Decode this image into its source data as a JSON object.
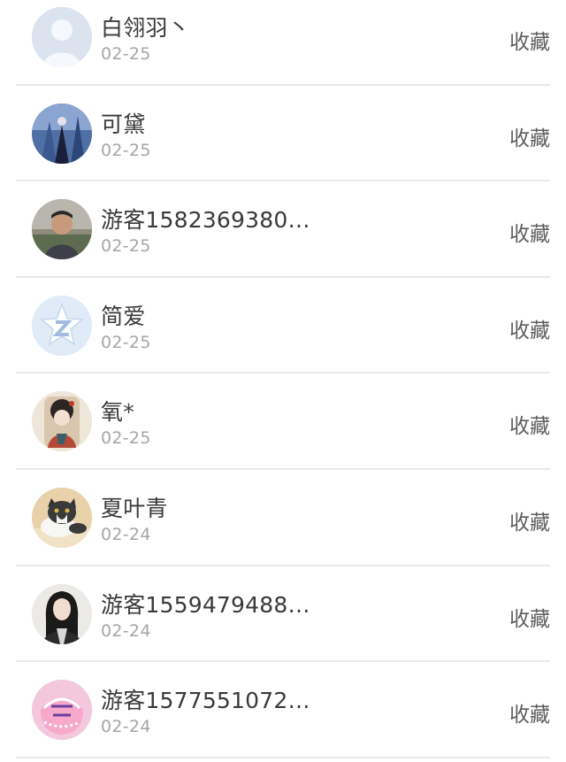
{
  "rows": [
    {
      "name": "白翎羽丶",
      "date": "02-25",
      "action": "收藏",
      "avatar": "default-person-avatar"
    },
    {
      "name": "可黛",
      "date": "02-25",
      "action": "收藏",
      "avatar": "blue-art-figure-avatar"
    },
    {
      "name": "游客1582369380…",
      "date": "02-25",
      "action": "收藏",
      "avatar": "man-photo-avatar"
    },
    {
      "name": "简爱",
      "date": "02-25",
      "action": "收藏",
      "avatar": "qzone-star-avatar"
    },
    {
      "name": "氧*",
      "date": "02-25",
      "action": "收藏",
      "avatar": "painted-lady-avatar"
    },
    {
      "name": "夏叶青",
      "date": "02-24",
      "action": "收藏",
      "avatar": "cat-photo-avatar"
    },
    {
      "name": "游客1559479488…",
      "date": "02-24",
      "action": "收藏",
      "avatar": "woman-photo-avatar"
    },
    {
      "name": "游客1577551072…",
      "date": "02-24",
      "action": "收藏",
      "avatar": "pink-cake-avatar"
    }
  ]
}
